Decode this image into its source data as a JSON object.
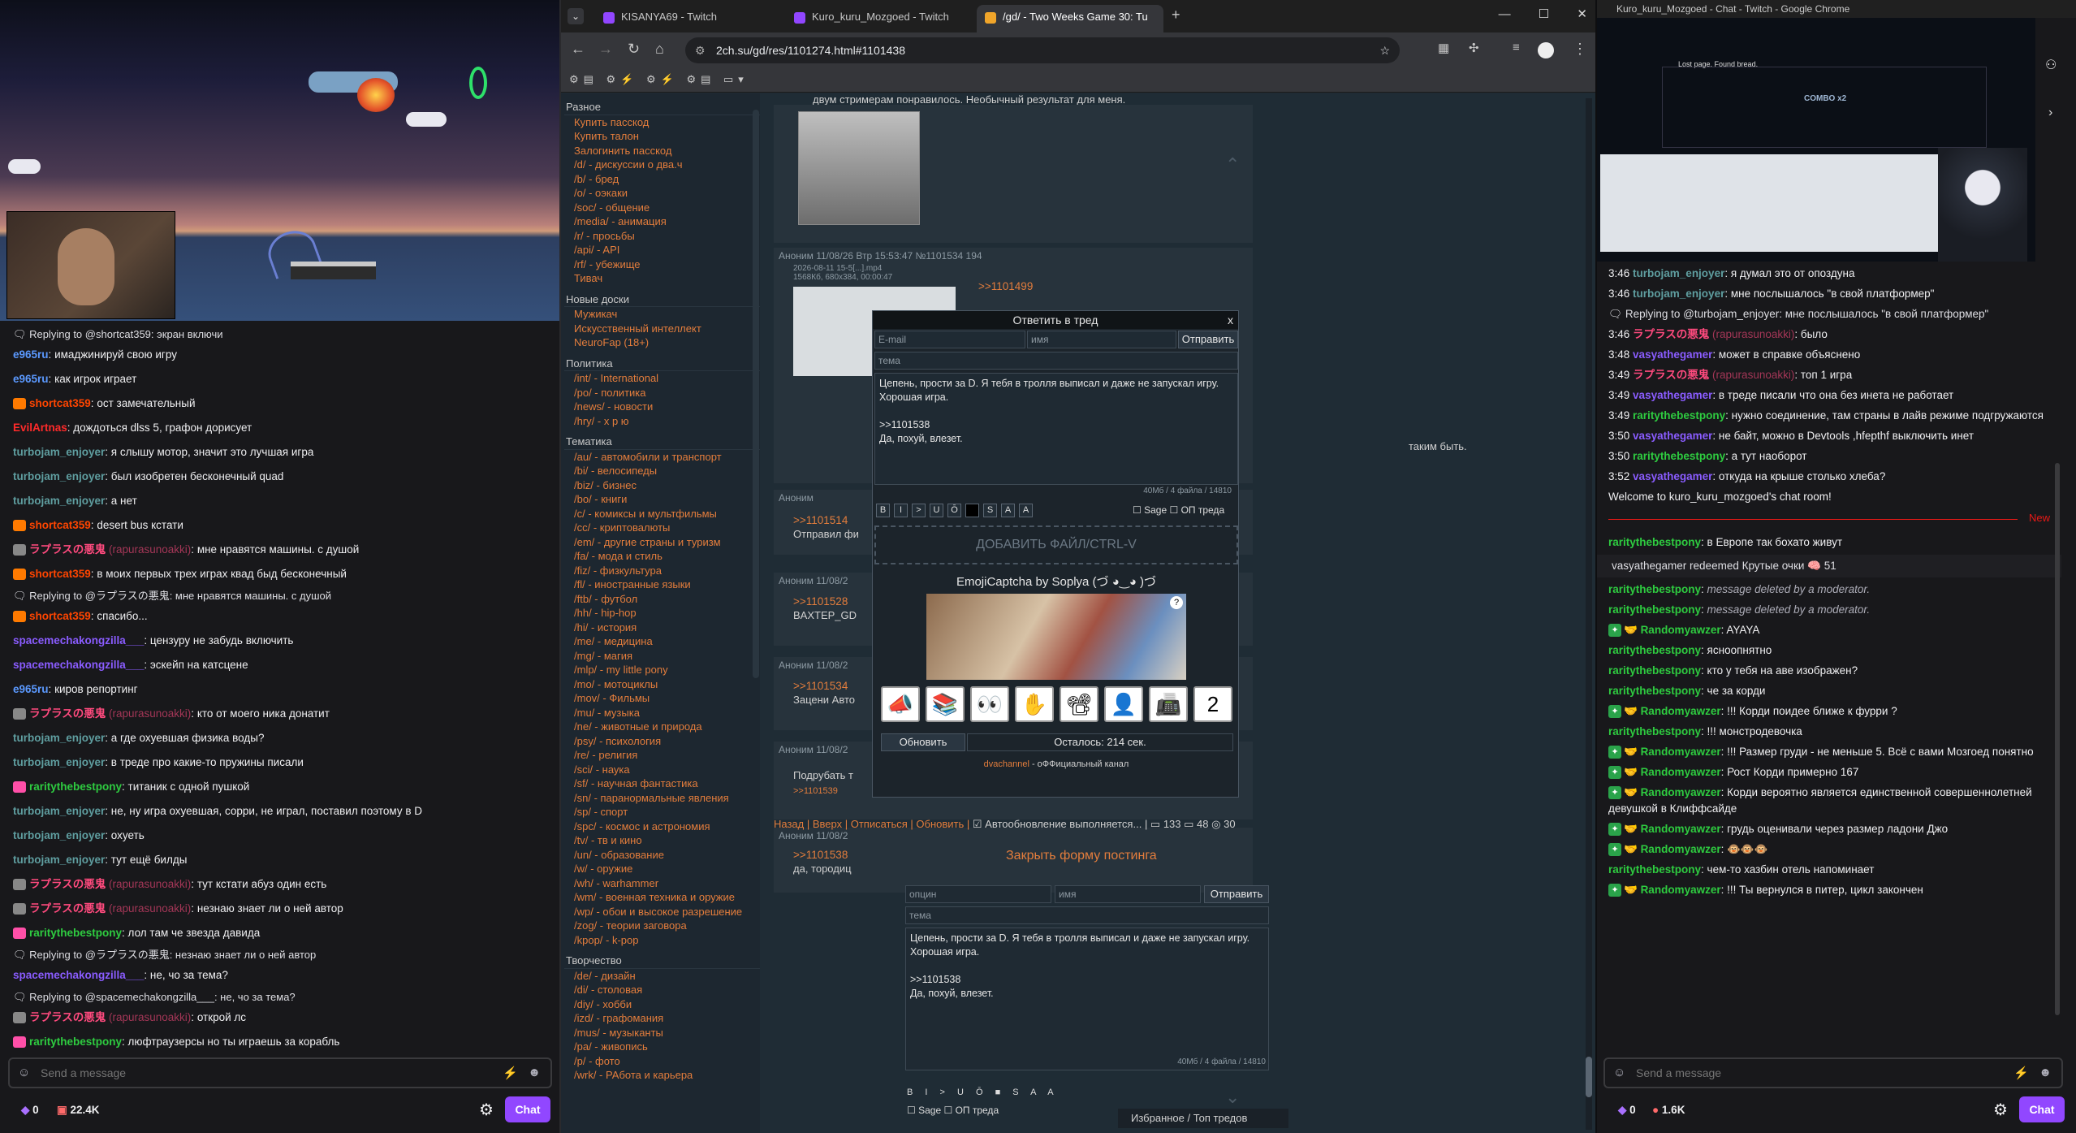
{
  "left": {
    "chat": [
      {
        "type": "reply",
        "text": "Replying to @shortcat359: экран включи"
      },
      {
        "type": "msg",
        "user": "e965ru",
        "color": "#5b99ff",
        "text": "имаджинируй свою игру"
      },
      {
        "type": "msg",
        "user": "e965ru",
        "color": "#5b99ff",
        "text": "как игрок играет"
      },
      {
        "type": "msg",
        "user": "shortcat359",
        "color": "#ff4500",
        "badge": "#ff7a00",
        "text": "ост замечательный"
      },
      {
        "type": "msg",
        "user": "EvilArtnas",
        "color": "#ff2a2a",
        "text": "дождоться dlss 5, графон дорисует"
      },
      {
        "type": "msg",
        "user": "turbojam_enjoyer",
        "color": "#5f9ea0",
        "text": "я слышу мотор, значит это лучшая игра"
      },
      {
        "type": "msg",
        "user": "turbojam_enjoyer",
        "color": "#5f9ea0",
        "text": "был изобретен бесконечный quad"
      },
      {
        "type": "msg",
        "user": "turbojam_enjoyer",
        "color": "#5f9ea0",
        "text": "а нет"
      },
      {
        "type": "msg",
        "user": "shortcat359",
        "color": "#ff4500",
        "badge": "#ff7a00",
        "text": "desert bus кстати"
      },
      {
        "type": "msg",
        "user": "ラプラスの悪鬼",
        "alt": "(rapurasunoakki)",
        "color": "#ff4a7e",
        "badge": "#888",
        "text": "мне нравятся машины. с душой"
      },
      {
        "type": "msg",
        "user": "shortcat359",
        "color": "#ff4500",
        "badge": "#ff7a00",
        "text": "в моих первых трех играх квад быд бесконечный"
      },
      {
        "type": "reply",
        "text": "Replying to @ラプラスの悪鬼: мне нравятся машины. с душой"
      },
      {
        "type": "msg",
        "user": "shortcat359",
        "color": "#ff4500",
        "badge": "#ff7a00",
        "text": "спасибо..."
      },
      {
        "type": "msg",
        "user": "spacemechakongzilla___",
        "color": "#8a5cff",
        "text": "цензуру не забудь включить"
      },
      {
        "type": "msg",
        "user": "spacemechakongzilla___",
        "color": "#8a5cff",
        "text": "эскейп на катсцене"
      },
      {
        "type": "msg",
        "user": "e965ru",
        "color": "#5b99ff",
        "text": "киров репортинг"
      },
      {
        "type": "msg",
        "user": "ラプラスの悪鬼",
        "alt": "(rapurasunoakki)",
        "color": "#ff4a7e",
        "badge": "#888",
        "text": "кто от моего ника донатит"
      },
      {
        "type": "msg",
        "user": "turbojam_enjoyer",
        "color": "#5f9ea0",
        "text": "а где охуевшая физика воды?"
      },
      {
        "type": "msg",
        "user": "turbojam_enjoyer",
        "color": "#5f9ea0",
        "text": "в треде про какие-то пружины писали"
      },
      {
        "type": "msg",
        "user": "raritythebestpony",
        "color": "#2ecc40",
        "badge": "#ff4fa8",
        "text": "титаник с одной пушкой"
      },
      {
        "type": "msg",
        "user": "turbojam_enjoyer",
        "color": "#5f9ea0",
        "text": "не, ну игра охуевшая, сорри, не играл, поставил поэтому в D"
      },
      {
        "type": "msg",
        "user": "turbojam_enjoyer",
        "color": "#5f9ea0",
        "text": "охуеть"
      },
      {
        "type": "msg",
        "user": "turbojam_enjoyer",
        "color": "#5f9ea0",
        "text": "тут ещё билды"
      },
      {
        "type": "msg",
        "user": "ラプラスの悪鬼",
        "alt": "(rapurasunoakki)",
        "color": "#ff4a7e",
        "badge": "#888",
        "text": "тут кстати абуз один есть"
      },
      {
        "type": "msg",
        "user": "ラプラスの悪鬼",
        "alt": "(rapurasunoakki)",
        "color": "#ff4a7e",
        "badge": "#888",
        "text": "незнаю знает ли о ней автор"
      },
      {
        "type": "msg",
        "user": "raritythebestpony",
        "color": "#2ecc40",
        "badge": "#ff4fa8",
        "text": "лол там че звезда давида"
      },
      {
        "type": "reply",
        "text": "Replying to @ラプラスの悪鬼: незнаю знает ли о ней автор"
      },
      {
        "type": "msg",
        "user": "spacemechakongzilla___",
        "color": "#8a5cff",
        "text": "не, чо за тема?"
      },
      {
        "type": "reply",
        "text": "Replying to @spacemechakongzilla___: не, чо за тема?"
      },
      {
        "type": "msg",
        "user": "ラプラスの悪鬼",
        "alt": "(rapurasunoakki)",
        "color": "#ff4a7e",
        "badge": "#888",
        "text": "открой лс"
      },
      {
        "type": "msg",
        "user": "raritythebestpony",
        "color": "#2ecc40",
        "badge": "#ff4fa8",
        "text": "люфтраузерсы но ты играешь за корабль"
      }
    ],
    "send_placeholder": "Send a message",
    "points": "0",
    "viewers": "22.4K",
    "chat_button": "Chat"
  },
  "browser": {
    "tabs": [
      {
        "label": "KISANYA69 - Twitch",
        "active": false
      },
      {
        "label": "Kuro_kuru_Mozgoed - Twitch",
        "active": false
      },
      {
        "label": "/gd/ - Two Weeks Game 30: Tu",
        "active": true
      }
    ],
    "url": "2ch.su/gd/res/1101274.html#1101438",
    "board": [
      {
        "section": "Разное",
        "links": [
          {
            "t": "Купить пасскод"
          },
          {
            "t": "Купить талон"
          },
          {
            "t": "Залогинить пасскод"
          },
          {
            "t": "/d/ - дискуссии о два.ч"
          },
          {
            "t": "/b/ - бред"
          },
          {
            "t": "/o/ - оэкаки"
          },
          {
            "t": "/soc/ - общение"
          },
          {
            "t": "/media/ - анимация"
          },
          {
            "t": "/r/ - просьбы"
          },
          {
            "t": "/api/ - API"
          },
          {
            "t": "/rf/ - убежище"
          },
          {
            "t": "Тивач"
          }
        ]
      },
      {
        "section": "Новые доски",
        "links": [
          {
            "t": "Мужикач"
          },
          {
            "t": "Искусственный интеллект"
          },
          {
            "t": "NeuroFap (18+)"
          }
        ]
      },
      {
        "section": "Политика",
        "links": [
          {
            "t": "/int/ - International"
          },
          {
            "t": "/po/ - политика"
          },
          {
            "t": "/news/ - новости"
          },
          {
            "t": "/hry/ - х р ю"
          }
        ]
      },
      {
        "section": "Тематика",
        "links": [
          {
            "t": "/au/ - автомобили и транспорт"
          },
          {
            "t": "/bi/ - велосипеды"
          },
          {
            "t": "/biz/ - бизнес"
          },
          {
            "t": "/bo/ - книги"
          },
          {
            "t": "/c/ - комиксы и мультфильмы"
          },
          {
            "t": "/cc/ - криптовалюты"
          },
          {
            "t": "/em/ - другие страны и туризм"
          },
          {
            "t": "/fa/ - мода и стиль"
          },
          {
            "t": "/fiz/ - физкультура"
          },
          {
            "t": "/fl/ - иностранные языки"
          },
          {
            "t": "/ftb/ - футбол"
          },
          {
            "t": "/hh/ - hip-hop"
          },
          {
            "t": "/hi/ - история"
          },
          {
            "t": "/me/ - медицина"
          },
          {
            "t": "/mg/ - магия"
          },
          {
            "t": "/mlp/ - my little pony"
          },
          {
            "t": "/mo/ - мотоциклы"
          },
          {
            "t": "/mov/ - Фильмы"
          },
          {
            "t": "/mu/ - музыка"
          },
          {
            "t": "/ne/ - животные и природа"
          },
          {
            "t": "/psy/ - психология"
          },
          {
            "t": "/re/ - религия"
          },
          {
            "t": "/sci/ - наука"
          },
          {
            "t": "/sf/ - научная фантастика"
          },
          {
            "t": "/sn/ - паранормальные явления"
          },
          {
            "t": "/sp/ - спорт"
          },
          {
            "t": "/spc/ - космос и астрономия"
          },
          {
            "t": "/tv/ - тв и кино"
          },
          {
            "t": "/un/ - образование"
          },
          {
            "t": "/w/ - оружие"
          },
          {
            "t": "/wh/ - warhammer"
          },
          {
            "t": "/wm/ - военная техника и оружие"
          },
          {
            "t": "/wp/ - обои и высокое разрешение"
          },
          {
            "t": "/zog/ - теории заговора"
          },
          {
            "t": "/kpop/ - k-pop"
          }
        ]
      },
      {
        "section": "Творчество",
        "links": [
          {
            "t": "/de/ - дизайн"
          },
          {
            "t": "/di/ - столовая"
          },
          {
            "t": "/diy/ - хобби"
          },
          {
            "t": "/izd/ - графомания"
          },
          {
            "t": "/mus/ - музыканты"
          },
          {
            "t": "/pa/ - живопись"
          },
          {
            "t": "/p/ - фото"
          },
          {
            "t": "/wrk/ - РАбота и карьера"
          }
        ]
      }
    ],
    "posts": [
      {
        "head": "Аноним  11/08/26 Втр 15:53:47 №1101534 194",
        "file": "2026-08-11 15-5[...].mp4",
        "fileinfo": "1568Кб, 680x384, 00:00:47",
        "ref": ">>1101499"
      },
      {
        "head": "Аноним",
        "ref": ">>1101514",
        "text": "Отправил фи",
        "tail": "таким быть."
      },
      {
        "head": "Аноним  11/08/2",
        "ref": ">>1101528",
        "text": "BAXTEP_GD"
      },
      {
        "head": "Аноним  11/08/2",
        "ref": ">>1101534",
        "text": "Зацени Авто"
      },
      {
        "head": "Аноним  11/08/2",
        "text": "Подрубать т",
        "ref": ">>1101539"
      },
      {
        "head": "Аноним  11/08/2",
        "ref": ">>1101538",
        "text": "да, тородиц"
      }
    ],
    "top_text": "двум стримерам понравилось. Необычный результат для меня.",
    "modal": {
      "title": "Ответить в тред",
      "email_placeholder": "E-mail",
      "name_placeholder": "имя",
      "send": "Отправить",
      "subject_placeholder": "тема",
      "body": "Цепень, прости за D. Я тебя в тролля выписал и даже не запускал игру. Хорошая игра.\n\n>>1101538\nДа, похуй, влезет.",
      "counter": "40Мб / 4 файла / 14810",
      "sage": "Sage",
      "op": "ОП треда",
      "dropzone": "ДОБАВИТЬ ФАЙЛ/CTRL-V",
      "captcha_title": "EmojiCaptcha by Soplya (づ ◕‿◕ )づ",
      "emojis": [
        "📣",
        "📚",
        "👀",
        "✋",
        "📽",
        "👤",
        "📠",
        "2"
      ],
      "refresh": "Обновить",
      "remaining": "Осталось: 214 сек.",
      "footer_link": "dvachannel",
      "footer_text": " - оФФициальный канал"
    },
    "thread_nav": {
      "back": "Назад",
      "top": "Вверх",
      "unsub": "Отписаться",
      "refresh": "Обновить",
      "auto": "Автообновление выполняется...",
      "count1": "133",
      "count2": "48",
      "count3": "30"
    },
    "close_form": "Закрыть форму постинга",
    "bottom_form": {
      "email_placeholder": "опцин",
      "name_placeholder": "имя",
      "send": "Отправить",
      "subject_placeholder": "тема",
      "body": "Цепень, прости за D. Я тебя в тролля выписал и даже не запускал игру. Хорошая игра.\n\n>>1101538\nДа, похуй, влезет.",
      "counter": "40Мб / 4 файла / 14810",
      "sage": "Sage",
      "op": "ОП треда"
    },
    "favorites": "Избранное / Топ тредов"
  },
  "right": {
    "window_title": "Kuro_kuru_Mozgoed - Chat - Twitch - Google Chrome",
    "video_text": [
      "Lost page. Found bread.",
      "COMBO x2"
    ],
    "chat": [
      {
        "time": "3:46",
        "user": "turbojam_enjoyer",
        "color": "#5f9ea0",
        "text": "я думал это от опоздуна"
      },
      {
        "time": "3:46",
        "user": "turbojam_enjoyer",
        "color": "#5f9ea0",
        "text": "мне послышалось \"в свой платформер\""
      },
      {
        "reply": "Replying to @turbojam_enjoyer: мне послышалось \"в свой платформер\""
      },
      {
        "time": "3:46",
        "user": "ラプラスの悪鬼",
        "alt": "(rapurasunoakki)",
        "color": "#ff4a7e",
        "text": "было"
      },
      {
        "time": "3:48",
        "user": "vasyathegamer",
        "color": "#8a5cff",
        "text": "может в справке объяснено"
      },
      {
        "time": "3:49",
        "user": "ラプラスの悪鬼",
        "alt": "(rapurasunoakki)",
        "color": "#ff4a7e",
        "text": "топ 1 игра"
      },
      {
        "time": "3:49",
        "user": "vasyathegamer",
        "color": "#8a5cff",
        "text": "в треде писали что она без инета не работает"
      },
      {
        "time": "3:49",
        "user": "raritythebestpony",
        "color": "#2ecc40",
        "text": "нужно соединение, там страны в лайв режиме подгружаются"
      },
      {
        "time": "3:50",
        "user": "vasyathegamer",
        "color": "#8a5cff",
        "text": "не байт, можно в Devtools ,hfepthf выключить инет"
      },
      {
        "time": "3:50",
        "user": "raritythebestpony",
        "color": "#2ecc40",
        "text": "а тут наоборот"
      },
      {
        "time": "3:52",
        "user": "vasyathegamer",
        "color": "#8a5cff",
        "text": "откуда на крыше столько хлеба?"
      },
      {
        "welcome": "Welcome to kuro_kuru_mozgoed's chat room!"
      }
    ],
    "new_label": "New",
    "chat2": [
      {
        "user": "raritythebestpony",
        "color": "#2ecc40",
        "text": "в Европе так бохато живут"
      },
      {
        "redeem": "vasyathegamer redeemed Крутые очки",
        "cost": "51"
      },
      {
        "user": "raritythebestpony",
        "color": "#2ecc40",
        "deleted": "message deleted by a moderator."
      },
      {
        "user": "raritythebestpony",
        "color": "#2ecc40",
        "deleted": "message deleted by a moderator."
      },
      {
        "user": "Randomyawzer",
        "color": "#2ecc40",
        "badge": true,
        "text": "AYAYA"
      },
      {
        "user": "raritythebestpony",
        "color": "#2ecc40",
        "text": "ясноопнятно"
      },
      {
        "user": "raritythebestpony",
        "color": "#2ecc40",
        "text": "кто у тебя на аве изображен?"
      },
      {
        "user": "raritythebestpony",
        "color": "#2ecc40",
        "text": "че за корди"
      },
      {
        "user": "Randomyawzer",
        "color": "#2ecc40",
        "badge": true,
        "text": "!!! Корди поидее ближе к фурри ?"
      },
      {
        "user": "raritythebestpony",
        "color": "#2ecc40",
        "text": "!!! монстродевочка"
      },
      {
        "user": "Randomyawzer",
        "color": "#2ecc40",
        "badge": true,
        "text": "!!! Размер груди - не меньше 5. Всё с вами Мозгоед понятно"
      },
      {
        "user": "Randomyawzer",
        "color": "#2ecc40",
        "badge": true,
        "text": "Рост Корди примерно 167"
      },
      {
        "user": "Randomyawzer",
        "color": "#2ecc40",
        "badge": true,
        "text": "Корди вероятно является единственной совершеннолетней девушкой в Клиффсайде"
      },
      {
        "user": "Randomyawzer",
        "color": "#2ecc40",
        "badge": true,
        "text": "грудь оценивали через размер ладони Джо"
      },
      {
        "user": "Randomyawzer",
        "color": "#2ecc40",
        "badge": true,
        "text": "🐵🐵🐵"
      },
      {
        "user": "raritythebestpony",
        "color": "#2ecc40",
        "text": "чем-то хазбин отель напоминает"
      },
      {
        "user": "Randomyawzer",
        "color": "#2ecc40",
        "badge": true,
        "text": "!!! Ты вернулся в питер, цикл закончен"
      }
    ],
    "send_placeholder": "Send a message",
    "points": "0",
    "viewers": "1.6K",
    "chat_button": "Chat"
  }
}
